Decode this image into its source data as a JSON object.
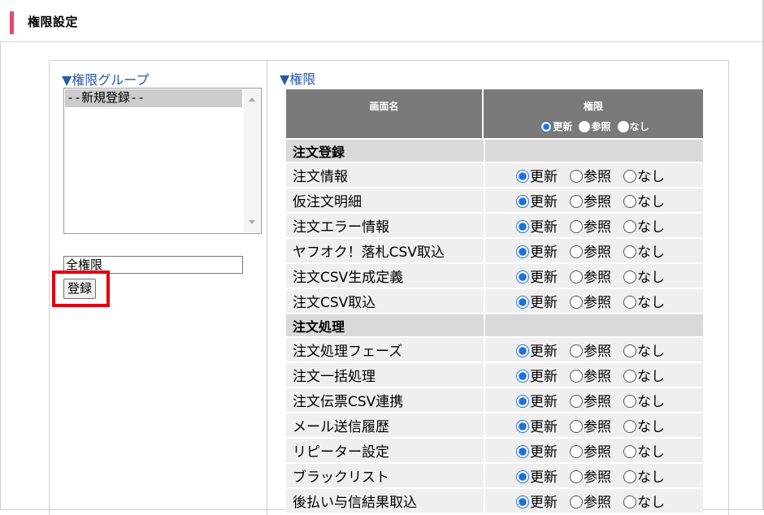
{
  "header": {
    "title": "権限設定",
    "accent_color": "#e8476b"
  },
  "left": {
    "section_title": "▼権限グループ",
    "listbox_options": [
      "--新規登録--"
    ],
    "name_input_value": "全権限",
    "register_button_label": "登録"
  },
  "right": {
    "section_title": "▼権限",
    "col_screen": "画面名",
    "col_permission": "権限",
    "header_radio_labels": [
      "更新",
      "参照",
      "なし"
    ],
    "radio_labels": [
      "更新",
      "参照",
      "なし"
    ],
    "categories": [
      {
        "name": "注文登録",
        "rows": [
          {
            "name": "注文情報",
            "selected": "更新"
          },
          {
            "name": "仮注文明細",
            "selected": "更新"
          },
          {
            "name": "注文エラー情報",
            "selected": "更新"
          },
          {
            "name": "ヤフオク！落札CSV取込",
            "selected": "更新"
          },
          {
            "name": "注文CSV生成定義",
            "selected": "更新"
          },
          {
            "name": "注文CSV取込",
            "selected": "更新"
          }
        ]
      },
      {
        "name": "注文処理",
        "rows": [
          {
            "name": "注文処理フェーズ",
            "selected": "更新"
          },
          {
            "name": "注文一括処理",
            "selected": "更新"
          },
          {
            "name": "注文伝票CSV連携",
            "selected": "更新"
          },
          {
            "name": "メール送信履歴",
            "selected": "更新"
          },
          {
            "name": "リピーター設定",
            "selected": "更新"
          },
          {
            "name": "ブラックリスト",
            "selected": "更新"
          },
          {
            "name": "後払い与信結果取込",
            "selected": "更新"
          }
        ]
      }
    ]
  },
  "colors": {
    "link_blue": "#2a5ba8",
    "highlight_red": "#e3000f",
    "radio_blue": "#1f6fe0"
  }
}
